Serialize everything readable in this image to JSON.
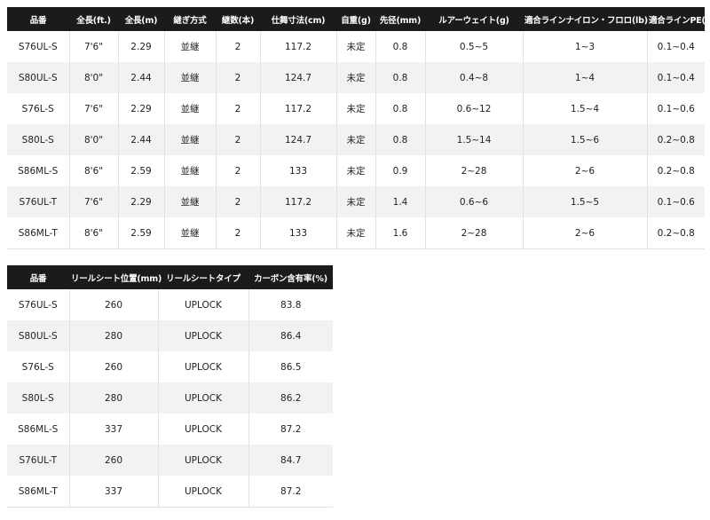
{
  "table1": {
    "headers": [
      "品番",
      "全長(ft.)",
      "全長(m)",
      "継ぎ方式",
      "継数(本)",
      "仕舞寸法(cm)",
      "自重(g)",
      "先径(mm)",
      "ルアーウェイト(g)",
      "適合ラインナイロン・フロロ(lb)",
      "適合ラインPE(号)"
    ],
    "rows": [
      [
        "S76UL-S",
        "7'6\"",
        "2.29",
        "並継",
        "2",
        "117.2",
        "未定",
        "0.8",
        "0.5~5",
        "1~3",
        "0.1~0.4"
      ],
      [
        "S80UL-S",
        "8'0\"",
        "2.44",
        "並継",
        "2",
        "124.7",
        "未定",
        "0.8",
        "0.4~8",
        "1~4",
        "0.1~0.4"
      ],
      [
        "S76L-S",
        "7'6\"",
        "2.29",
        "並継",
        "2",
        "117.2",
        "未定",
        "0.8",
        "0.6~12",
        "1.5~4",
        "0.1~0.6"
      ],
      [
        "S80L-S",
        "8'0\"",
        "2.44",
        "並継",
        "2",
        "124.7",
        "未定",
        "0.8",
        "1.5~14",
        "1.5~6",
        "0.2~0.8"
      ],
      [
        "S86ML-S",
        "8'6\"",
        "2.59",
        "並継",
        "2",
        "133",
        "未定",
        "0.9",
        "2~28",
        "2~6",
        "0.2~0.8"
      ],
      [
        "S76UL-T",
        "7'6\"",
        "2.29",
        "並継",
        "2",
        "117.2",
        "未定",
        "1.4",
        "0.6~6",
        "1.5~5",
        "0.1~0.6"
      ],
      [
        "S86ML-T",
        "8'6\"",
        "2.59",
        "並継",
        "2",
        "133",
        "未定",
        "1.6",
        "2~28",
        "2~6",
        "0.2~0.8"
      ]
    ]
  },
  "table2": {
    "headers": [
      "品番",
      "リールシート位置(mm)",
      "リールシートタイプ",
      "カーボン含有率(%)"
    ],
    "rows": [
      [
        "S76UL-S",
        "260",
        "UPLOCK",
        "83.8"
      ],
      [
        "S80UL-S",
        "280",
        "UPLOCK",
        "86.4"
      ],
      [
        "S76L-S",
        "260",
        "UPLOCK",
        "86.5"
      ],
      [
        "S80L-S",
        "280",
        "UPLOCK",
        "86.2"
      ],
      [
        "S86ML-S",
        "337",
        "UPLOCK",
        "87.2"
      ],
      [
        "S76UL-T",
        "260",
        "UPLOCK",
        "84.7"
      ],
      [
        "S86ML-T",
        "337",
        "UPLOCK",
        "87.2"
      ]
    ]
  }
}
